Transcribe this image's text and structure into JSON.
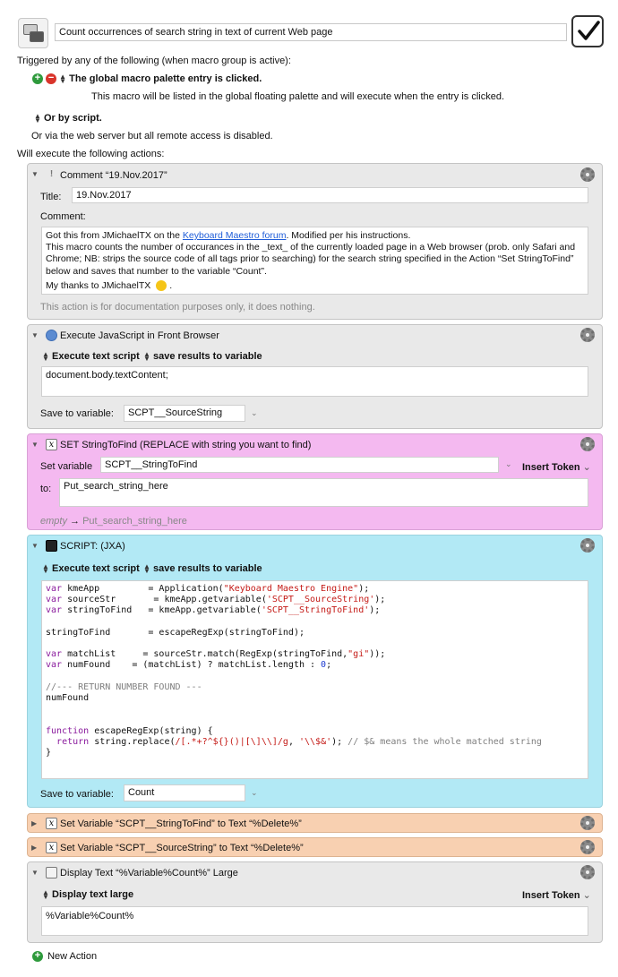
{
  "macro": {
    "name": "Count occurrences of search string in text of current Web page",
    "enabled": true
  },
  "triggers": {
    "intro": "Triggered by any of the following (when macro group is active):",
    "palette_trigger": "The global macro palette entry is clicked.",
    "palette_desc": "This macro will be listed in the global floating palette and will execute when the entry is clicked.",
    "script_trigger": "Or by script.",
    "web_server": "Or via the web server but all remote access is disabled."
  },
  "will_execute": "Will execute the following actions:",
  "comment_action": {
    "title": "Comment “19.Nov.2017”",
    "title_label": "Title:",
    "title_value": "19.Nov.2017",
    "comment_label": "Comment:",
    "line1_prefix": "Got this from JMichaelTX on the ",
    "line1_link": "Keyboard Maestro forum",
    "line1_suffix": ".  Modified per his instructions.",
    "line2": "This macro counts the number of occurances in the _text_ of the currently loaded page in a Web browser (prob. only Safari and Chrome; NB: strips the source code of all tags prior to searching) for the search string specified in the Action “Set StringToFind” below and saves that number to the variable “Count”.",
    "line3": "My thanks to JMichaelTX",
    "note": "This action is for documentation purposes only, it does nothing."
  },
  "js_action": {
    "title": "Execute JavaScript in Front Browser",
    "option_execute": "Execute text script",
    "option_save": "save results to variable",
    "script": "document.body.textContent;",
    "save_label": "Save to variable:",
    "save_value": "SCPT__SourceString"
  },
  "set_action": {
    "title": "SET StringToFind (REPLACE with string you want to find)",
    "var_label": "Set variable",
    "var_value": "SCPT__StringToFind",
    "insert_token": "Insert Token",
    "to_label": "to:",
    "to_value": "Put_search_string_here",
    "preview_empty": "empty",
    "preview_arrow": "→",
    "preview_value": "Put_search_string_here"
  },
  "script_action": {
    "title": "SCRIPT:   (JXA)",
    "option_execute": "Execute text script",
    "option_save": "save results to variable",
    "save_label": "Save to variable:",
    "save_value": "Count"
  },
  "clear1": {
    "title": "Set Variable “SCPT__StringToFind” to Text “%Delete%”"
  },
  "clear2": {
    "title": "Set Variable “SCPT__SourceString” to Text “%Delete%”"
  },
  "display_action": {
    "title": "Display Text “%Variable%Count%” Large",
    "option": "Display text large",
    "insert_token": "Insert Token",
    "text": "%Variable%Count%"
  },
  "new_action": "New Action",
  "colors": {
    "comment_bg": "#e9e9e9",
    "set_bg": "#f4b9f0",
    "script_bg": "#b2e9f5",
    "clear_bg": "#f8d0b1"
  }
}
